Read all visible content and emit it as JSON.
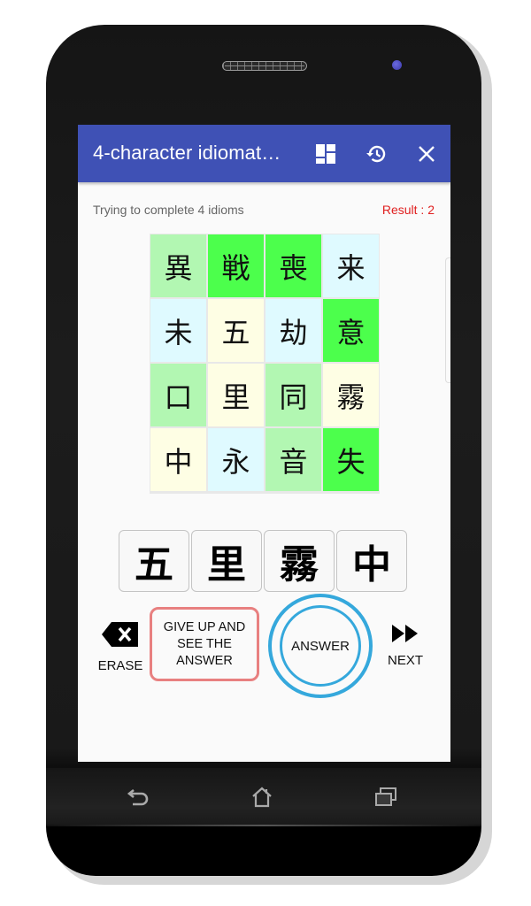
{
  "device": {
    "nav": {
      "back_icon": "back-arrow-icon",
      "home_icon": "home-icon",
      "recents_icon": "recents-icon"
    }
  },
  "appbar": {
    "title": "4-character idiomat…",
    "icons": [
      "grid-layout-icon",
      "history-icon",
      "close-icon"
    ],
    "color": "#3f51b5"
  },
  "status": {
    "text": "Trying to complete 4 idioms",
    "result": "Result : 2",
    "result_color": "#e02020"
  },
  "colors": {
    "bright_green": "#4cff4c",
    "light_green": "#b2f7b2",
    "light_cyan": "#dffaff",
    "light_yellow": "#fefee4"
  },
  "grid": {
    "cells": [
      {
        "char": "異",
        "color": "light_green"
      },
      {
        "char": "戦",
        "color": "bright_green"
      },
      {
        "char": "喪",
        "color": "bright_green"
      },
      {
        "char": "来",
        "color": "light_cyan"
      },
      {
        "char": "未",
        "color": "light_cyan"
      },
      {
        "char": "五",
        "color": "light_yellow"
      },
      {
        "char": "劫",
        "color": "light_cyan"
      },
      {
        "char": "意",
        "color": "bright_green"
      },
      {
        "char": "口",
        "color": "light_green"
      },
      {
        "char": "里",
        "color": "light_yellow"
      },
      {
        "char": "同",
        "color": "light_green"
      },
      {
        "char": "霧",
        "color": "light_yellow"
      },
      {
        "char": "中",
        "color": "light_yellow"
      },
      {
        "char": "永",
        "color": "light_cyan"
      },
      {
        "char": "音",
        "color": "light_green"
      },
      {
        "char": "失",
        "color": "bright_green"
      }
    ]
  },
  "answer": {
    "chars": [
      "五",
      "里",
      "霧",
      "中"
    ]
  },
  "controls": {
    "erase_label": "ERASE",
    "giveup_label": "GIVE UP AND SEE THE ANSWER",
    "answer_label": "ANSWER",
    "next_label": "NEXT",
    "giveup_border": "#e88080",
    "answer_ring": "#35a8dc"
  }
}
